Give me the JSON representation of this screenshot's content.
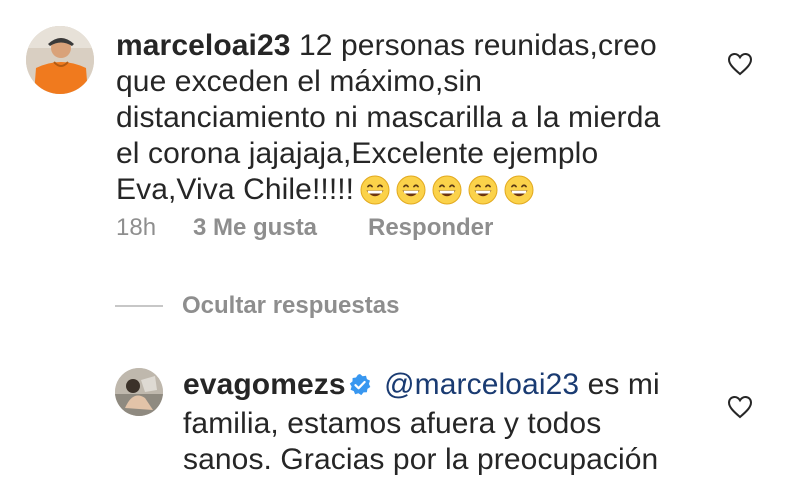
{
  "comment": {
    "username": "marceloai23",
    "text_line1": "12 personas reunidas,creo",
    "text_line2": "que exceden el máximo,sin",
    "text_line3": "distanciamiento ni mascarilla a la mierda",
    "text_line4": "el corona jajajaja,Excelente ejemplo",
    "text_line5": "Eva,Viva Chile!!!!!",
    "emoji": "grinning-face-with-smiling-eyes",
    "emoji_count": 5,
    "time": "18h",
    "likes": "3 Me gusta",
    "reply_label": "Responder"
  },
  "thread": {
    "hide_replies_label": "Ocultar respuestas"
  },
  "reply": {
    "username": "evagomezs",
    "verified_icon": "verified-badge-icon",
    "mention": "@marceloai23",
    "text_line1": "es mi",
    "text_line2": "familia, estamos afuera y todos",
    "text_line3": "sanos. Gracias por la preocupación"
  },
  "colors": {
    "text": "#262626",
    "secondary": "#8e8e8e",
    "mention": "#1a3b72",
    "verified": "#3897f0"
  }
}
